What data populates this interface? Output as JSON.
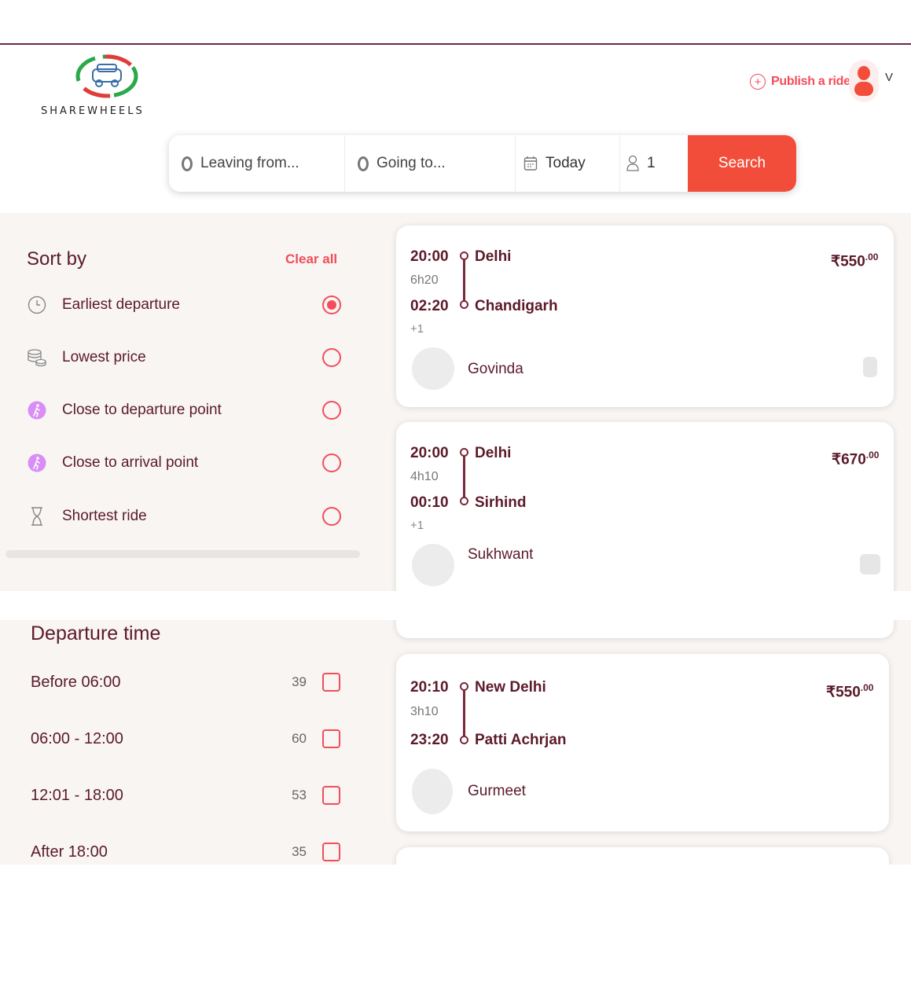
{
  "brand": {
    "name": "SHAREWHEELS"
  },
  "header": {
    "publish_label": "Publish a ride",
    "chevron": "V"
  },
  "search": {
    "from_placeholder": "Leaving from...",
    "to_placeholder": "Going to...",
    "date": "Today",
    "passengers": "1",
    "button": "Search"
  },
  "sort": {
    "title": "Sort by",
    "clear_label": "Clear all",
    "options": [
      {
        "label": "Earliest departure",
        "icon": "clock-icon",
        "selected": true
      },
      {
        "label": "Lowest price",
        "icon": "coins-icon",
        "selected": false
      },
      {
        "label": "Close to departure point",
        "icon": "walking-icon",
        "selected": false
      },
      {
        "label": "Close to arrival point",
        "icon": "walking-icon",
        "selected": false
      },
      {
        "label": "Shortest ride",
        "icon": "hourglass-icon",
        "selected": false
      }
    ]
  },
  "departure": {
    "title": "Departure time",
    "options": [
      {
        "label": "Before 06:00",
        "count": "39"
      },
      {
        "label": "06:00 - 12:00",
        "count": "60"
      },
      {
        "label": "12:01 - 18:00",
        "count": "53"
      },
      {
        "label": "After 18:00",
        "count": "35"
      }
    ]
  },
  "rides": [
    {
      "dep_time": "20:00",
      "from": "Delhi",
      "duration": "6h20",
      "arr_time": "02:20",
      "to": "Chandigarh",
      "day_offset": "+1",
      "price": "₹550",
      "price_dec": ".00",
      "driver": "Govinda"
    },
    {
      "dep_time": "20:00",
      "from": "Delhi",
      "duration": "4h10",
      "arr_time": "00:10",
      "to": "Sirhind",
      "day_offset": "+1",
      "price": "₹670",
      "price_dec": ".00",
      "driver": "Sukhwant"
    },
    {
      "dep_time": "20:10",
      "from": "New Delhi",
      "duration": "3h10",
      "arr_time": "23:20",
      "to": "Patti Achrjan",
      "price": "₹550",
      "price_dec": ".00",
      "driver": "Gurmeet"
    }
  ],
  "colors": {
    "accent": "#f24d3a",
    "text": "#5b1a2a",
    "route": "#7a2a3a",
    "panel_bg": "#f8f5f3"
  }
}
